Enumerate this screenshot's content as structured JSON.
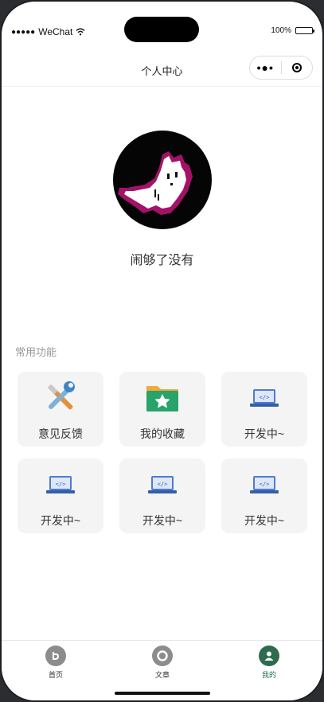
{
  "status": {
    "carrier": "WeChat",
    "battery": "100%"
  },
  "nav": {
    "title": "个人中心"
  },
  "profile": {
    "nickname": "闹够了没有"
  },
  "section": {
    "title": "常用功能"
  },
  "functions": [
    {
      "label": "意见反馈",
      "icon": "wrench-screwdriver-icon"
    },
    {
      "label": "我的收藏",
      "icon": "folder-star-icon"
    },
    {
      "label": "开发中~",
      "icon": "laptop-code-icon"
    },
    {
      "label": "开发中~",
      "icon": "laptop-code-icon"
    },
    {
      "label": "开发中~",
      "icon": "laptop-code-icon"
    },
    {
      "label": "开发中~",
      "icon": "laptop-code-icon"
    }
  ],
  "tabbar": {
    "items": [
      {
        "label": "首页",
        "icon": "home-icon",
        "active": false
      },
      {
        "label": "文章",
        "icon": "article-icon",
        "active": false
      },
      {
        "label": "我的",
        "icon": "user-icon",
        "active": true
      }
    ],
    "active_color": "#2e6b4f",
    "inactive_color": "#8c8c8c"
  }
}
